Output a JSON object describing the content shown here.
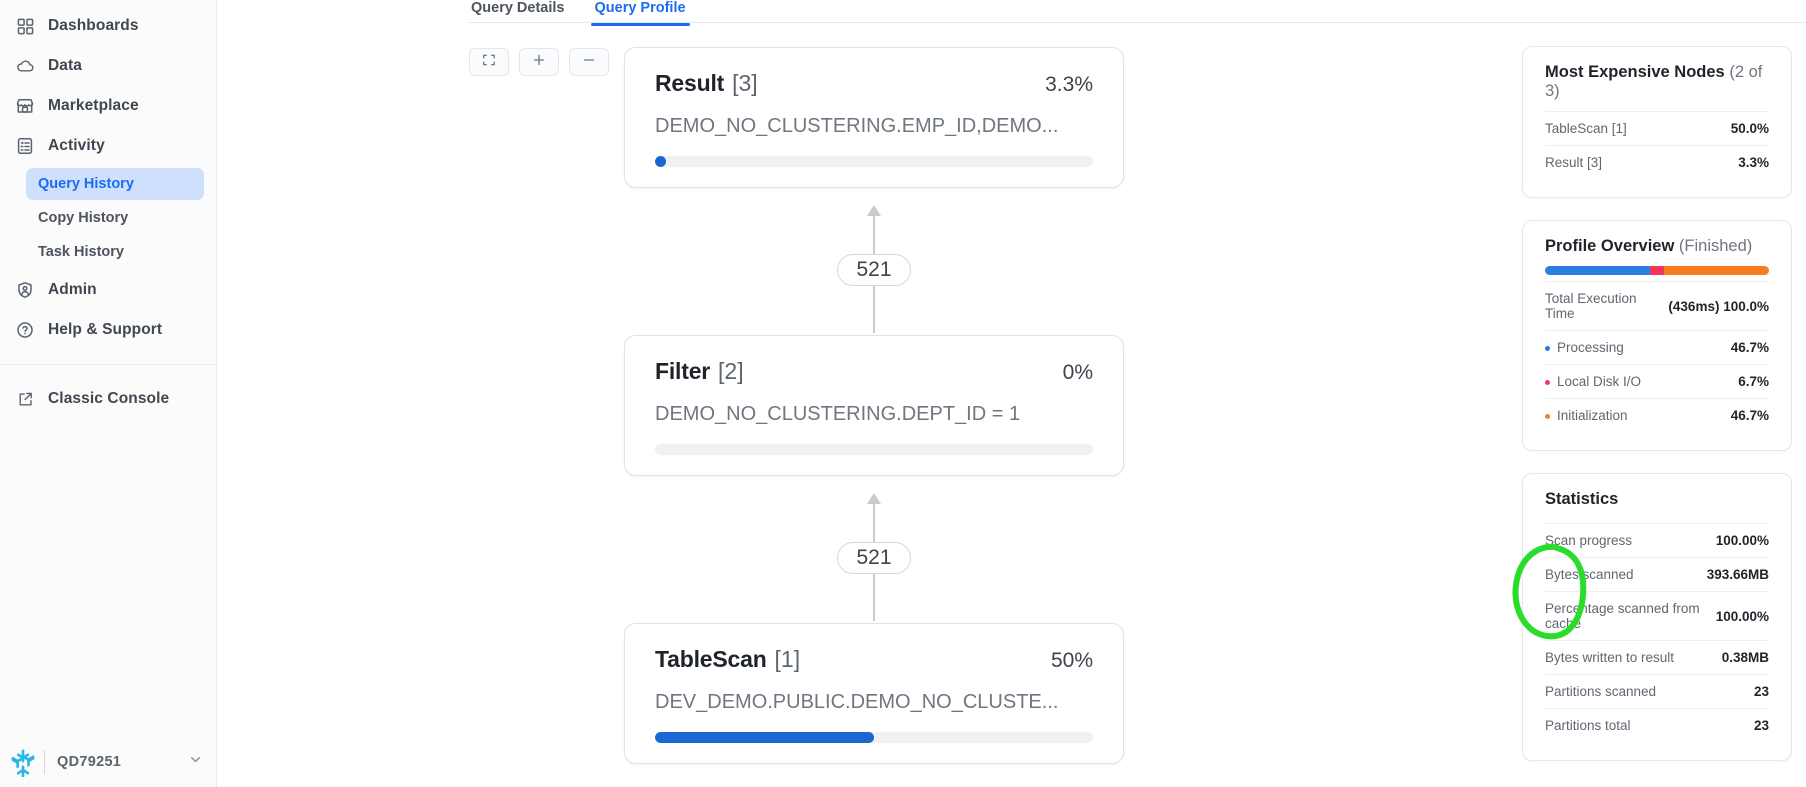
{
  "sidebar": {
    "items": [
      {
        "label": "Dashboards",
        "icon": "grid-icon"
      },
      {
        "label": "Data",
        "icon": "cloud-icon"
      },
      {
        "label": "Marketplace",
        "icon": "store-icon"
      },
      {
        "label": "Activity",
        "icon": "activity-icon"
      }
    ],
    "sub_items": [
      {
        "label": "Query History",
        "active": true
      },
      {
        "label": "Copy History",
        "active": false
      },
      {
        "label": "Task History",
        "active": false
      }
    ],
    "bottom_items": [
      {
        "label": "Admin",
        "icon": "shield-person-icon"
      },
      {
        "label": "Help & Support",
        "icon": "question-circle-icon"
      }
    ],
    "external_item": {
      "label": "Classic Console",
      "icon": "external-link-icon"
    },
    "account": {
      "name": "QD79251",
      "logo": "snowflake-logo",
      "chevron": "chevron-down-icon"
    }
  },
  "tabs": [
    {
      "label": "Query Details",
      "active": false
    },
    {
      "label": "Query Profile",
      "active": true
    }
  ],
  "toolbar": {
    "buttons": [
      {
        "name": "fit-screen-button",
        "icon": "fullscreen-icon"
      },
      {
        "name": "zoom-in-button",
        "icon": "plus-icon"
      },
      {
        "name": "zoom-out-button",
        "icon": "minus-icon"
      }
    ]
  },
  "graph": {
    "nodes": [
      {
        "title": "Result",
        "index": "[3]",
        "percent": "3.3%",
        "detail": "DEMO_NO_CLUSTERING.EMP_ID,DEMO...",
        "bar_percent": 3.3,
        "bar_style": "dot"
      },
      {
        "title": "Filter",
        "index": "[2]",
        "percent": "0%",
        "detail": "DEMO_NO_CLUSTERING.DEPT_ID = 1",
        "bar_percent": 0,
        "bar_style": "empty"
      },
      {
        "title": "TableScan",
        "index": "[1]",
        "percent": "50%",
        "detail": "DEV_DEMO.PUBLIC.DEMO_NO_CLUSTE...",
        "bar_percent": 50,
        "bar_style": "fill"
      }
    ],
    "edges": [
      {
        "label": "521"
      },
      {
        "label": "521"
      }
    ]
  },
  "most_expensive_nodes": {
    "title": "Most Expensive Nodes",
    "subtitle": "(2 of 3)",
    "rows": [
      {
        "name": "TableScan [1]",
        "value": "50.0%"
      },
      {
        "name": "Result [3]",
        "value": "3.3%"
      }
    ]
  },
  "profile_overview": {
    "title": "Profile Overview",
    "subtitle": "(Finished)",
    "total_label": "Total Execution Time",
    "total_value": "(436ms) 100.0%",
    "bar_segments": [
      {
        "color": "#2a7de1",
        "percent": 46.7
      },
      {
        "color": "#f5365c",
        "percent": 6.7
      },
      {
        "color": "#f97d20",
        "percent": 46.7
      }
    ],
    "rows": [
      {
        "name": "Processing",
        "value": "46.7%",
        "color": "#2a7de1"
      },
      {
        "name": "Local Disk I/O",
        "value": "6.7%",
        "color": "#f5365c"
      },
      {
        "name": "Initialization",
        "value": "46.7%",
        "color": "#f97d20"
      }
    ]
  },
  "statistics": {
    "title": "Statistics",
    "rows": [
      {
        "name": "Scan progress",
        "value": "100.00%"
      },
      {
        "name": "Bytes scanned",
        "value": "393.66MB"
      },
      {
        "name": "Percentage scanned from cache",
        "value": "100.00%"
      },
      {
        "name": "Bytes written to result",
        "value": "0.38MB"
      },
      {
        "name": "Partitions scanned",
        "value": "23"
      },
      {
        "name": "Partitions total",
        "value": "23"
      }
    ],
    "annotation": {
      "type": "hand-drawn-ellipse",
      "color": "#2bdd2b"
    }
  },
  "colors": {
    "accent": "#1b6cf0",
    "bar_blue": "#1967d2",
    "annotation_green": "#2bdd2b"
  }
}
